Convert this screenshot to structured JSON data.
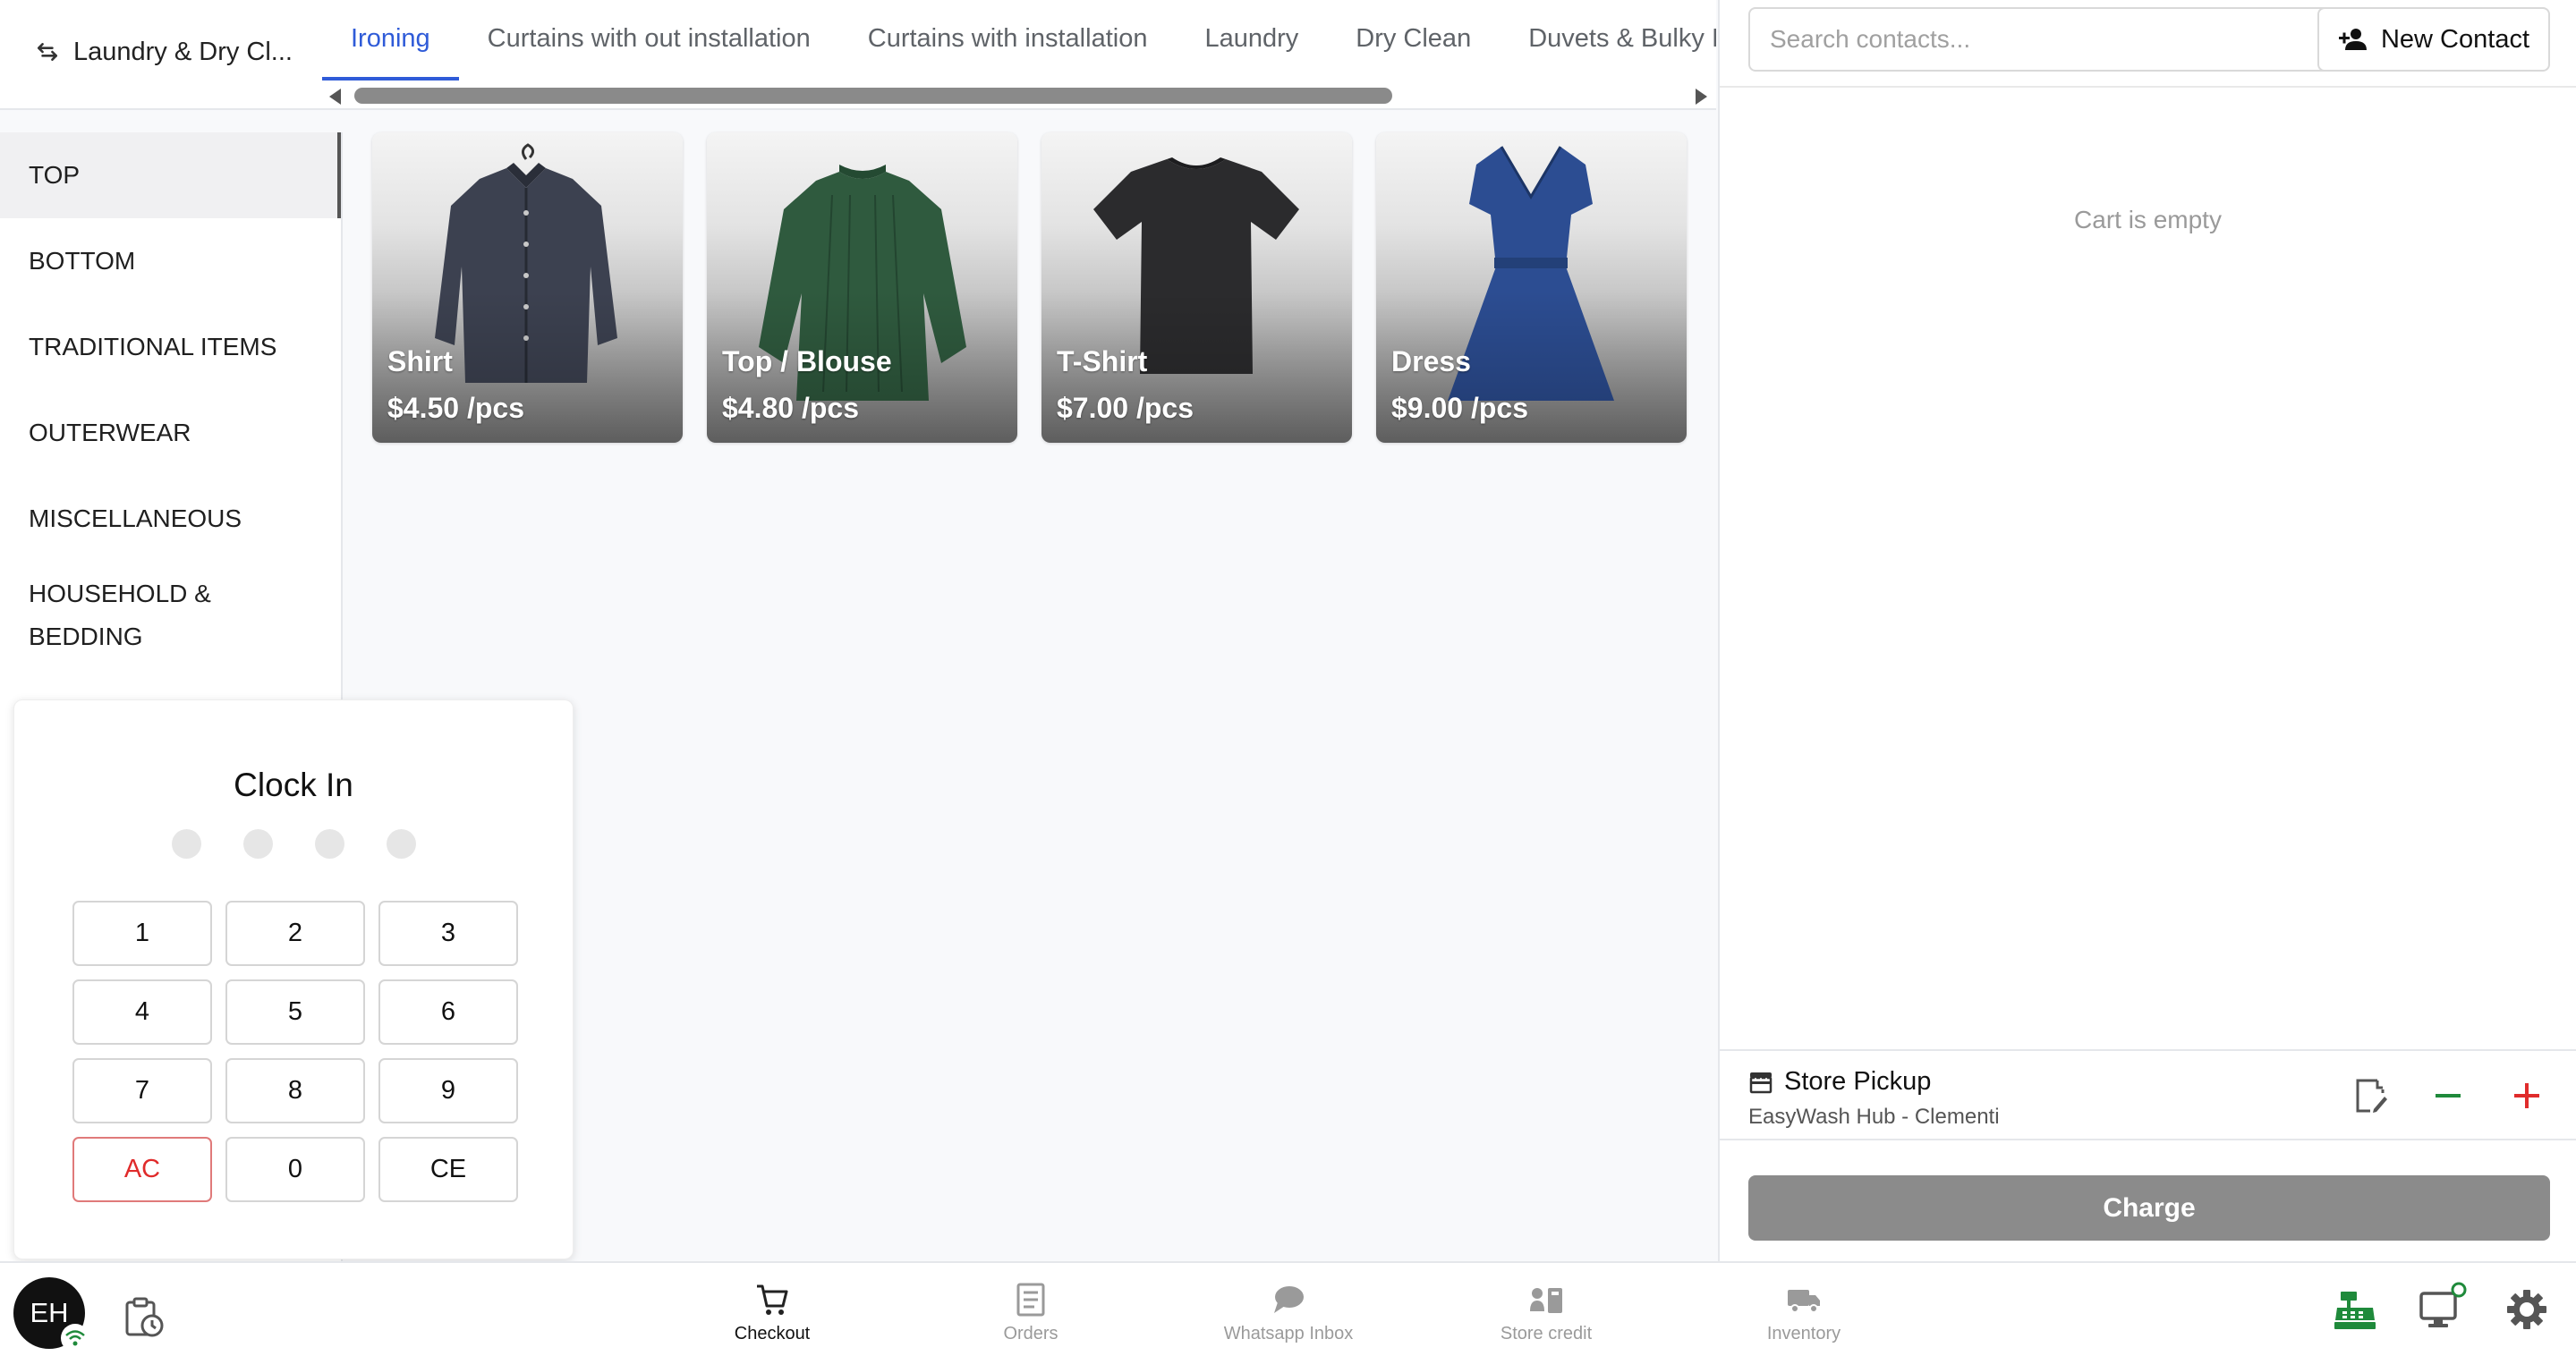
{
  "store_switch": {
    "label": "Laundry & Dry Cl..."
  },
  "tabs": [
    {
      "label": "Ironing",
      "active": true
    },
    {
      "label": "Curtains with out installation",
      "active": false
    },
    {
      "label": "Curtains with installation",
      "active": false
    },
    {
      "label": "Laundry",
      "active": false
    },
    {
      "label": "Dry Clean",
      "active": false
    },
    {
      "label": "Duvets & Bulky Iten",
      "active": false
    }
  ],
  "categories": [
    {
      "label": "TOP",
      "active": true
    },
    {
      "label": "BOTTOM",
      "active": false
    },
    {
      "label": "TRADITIONAL ITEMS",
      "active": false
    },
    {
      "label": "OUTERWEAR",
      "active": false
    },
    {
      "label": "MISCELLANEOUS",
      "active": false
    },
    {
      "label": "HOUSEHOLD & BEDDING",
      "active": false
    }
  ],
  "products": [
    {
      "name": "Shirt",
      "price": "$4.50 /pcs",
      "icon": "shirt-image",
      "color": "#3c4150"
    },
    {
      "name": "Top / Blouse",
      "price": "$4.80 /pcs",
      "icon": "blouse-image",
      "color": "#2f5a3e"
    },
    {
      "name": "T-Shirt",
      "price": "$7.00 /pcs",
      "icon": "tshirt-image",
      "color": "#2b2b2d"
    },
    {
      "name": "Dress",
      "price": "$9.00 /pcs",
      "icon": "dress-image",
      "color": "#2c4d92"
    }
  ],
  "clock_in": {
    "title": "Clock In",
    "pin_length": 4,
    "keys": [
      "1",
      "2",
      "3",
      "4",
      "5",
      "6",
      "7",
      "8",
      "9",
      "AC",
      "0",
      "CE"
    ]
  },
  "contacts": {
    "search_placeholder": "Search contacts...",
    "new_contact_label": "New Contact"
  },
  "cart": {
    "empty_text": "Cart is empty"
  },
  "pickup": {
    "method": "Store Pickup",
    "location": "EasyWash Hub - Clementi"
  },
  "charge_label": "Charge",
  "user": {
    "initials": "EH"
  },
  "bottom_nav": [
    {
      "label": "Checkout",
      "icon": "cart-icon",
      "active": true
    },
    {
      "label": "Orders",
      "icon": "orders-icon",
      "active": false
    },
    {
      "label": "Whatsapp Inbox",
      "icon": "chat-icon",
      "active": false
    },
    {
      "label": "Store credit",
      "icon": "store-credit-icon",
      "active": false
    },
    {
      "label": "Inventory",
      "icon": "truck-icon",
      "active": false
    }
  ],
  "colors": {
    "accent": "#2f5bd8",
    "danger": "#e02b2b",
    "success": "#1f8a3b",
    "charge_disabled": "#8b8b8b"
  }
}
